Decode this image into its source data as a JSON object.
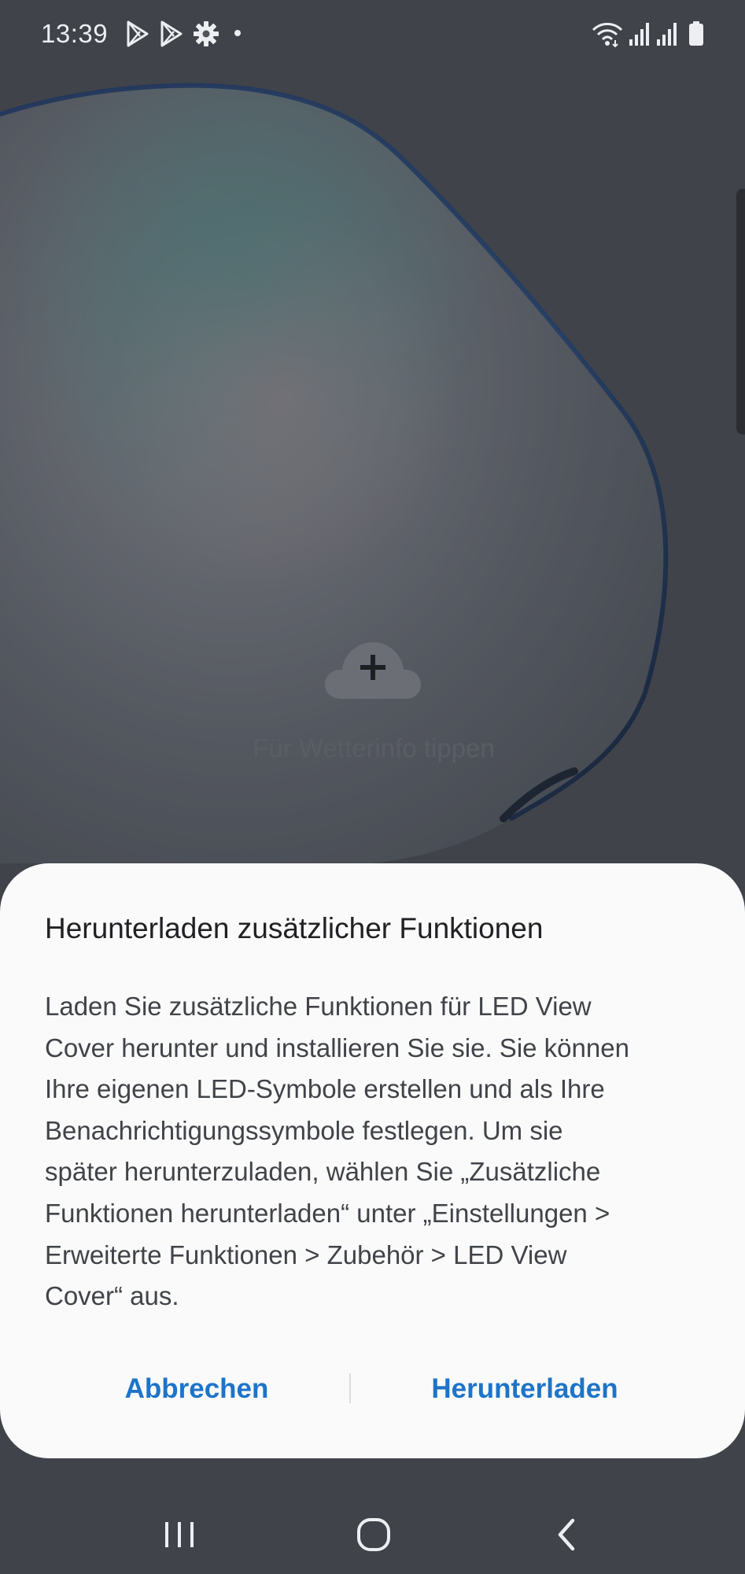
{
  "status_bar": {
    "time": "13:39",
    "left_icons": [
      "play-store-icon",
      "play-store-icon",
      "settings-gear-icon",
      "notification-dot-icon"
    ],
    "right_icons": [
      "wifi-icon",
      "signal-icon",
      "signal-icon",
      "battery-icon"
    ]
  },
  "weather": {
    "icon": "cloud-add-icon",
    "prompt": "Für Wetterinfo tippen"
  },
  "dialog": {
    "title": "Herunterladen zusätzlicher Funktionen",
    "message": "Laden Sie zusätzliche Funktionen für LED View\nCover herunter und installieren Sie sie. Sie können\nIhre eigenen LED-Symbole erstellen und als Ihre\nBenachrichtigungssymbole festlegen. Um sie\nspäter herunterzuladen, wählen Sie „Zusätzliche\nFunktionen herunterladen“ unter „Einstellungen >\nErweiterte Funktionen > Zubehör > LED View\nCover“ aus.",
    "cancel_label": "Abbrechen",
    "confirm_label": "Herunterladen",
    "accent_color": "#1d74c9"
  },
  "nav_bar": {
    "icons": [
      "recents-icon",
      "home-icon",
      "back-icon"
    ]
  }
}
